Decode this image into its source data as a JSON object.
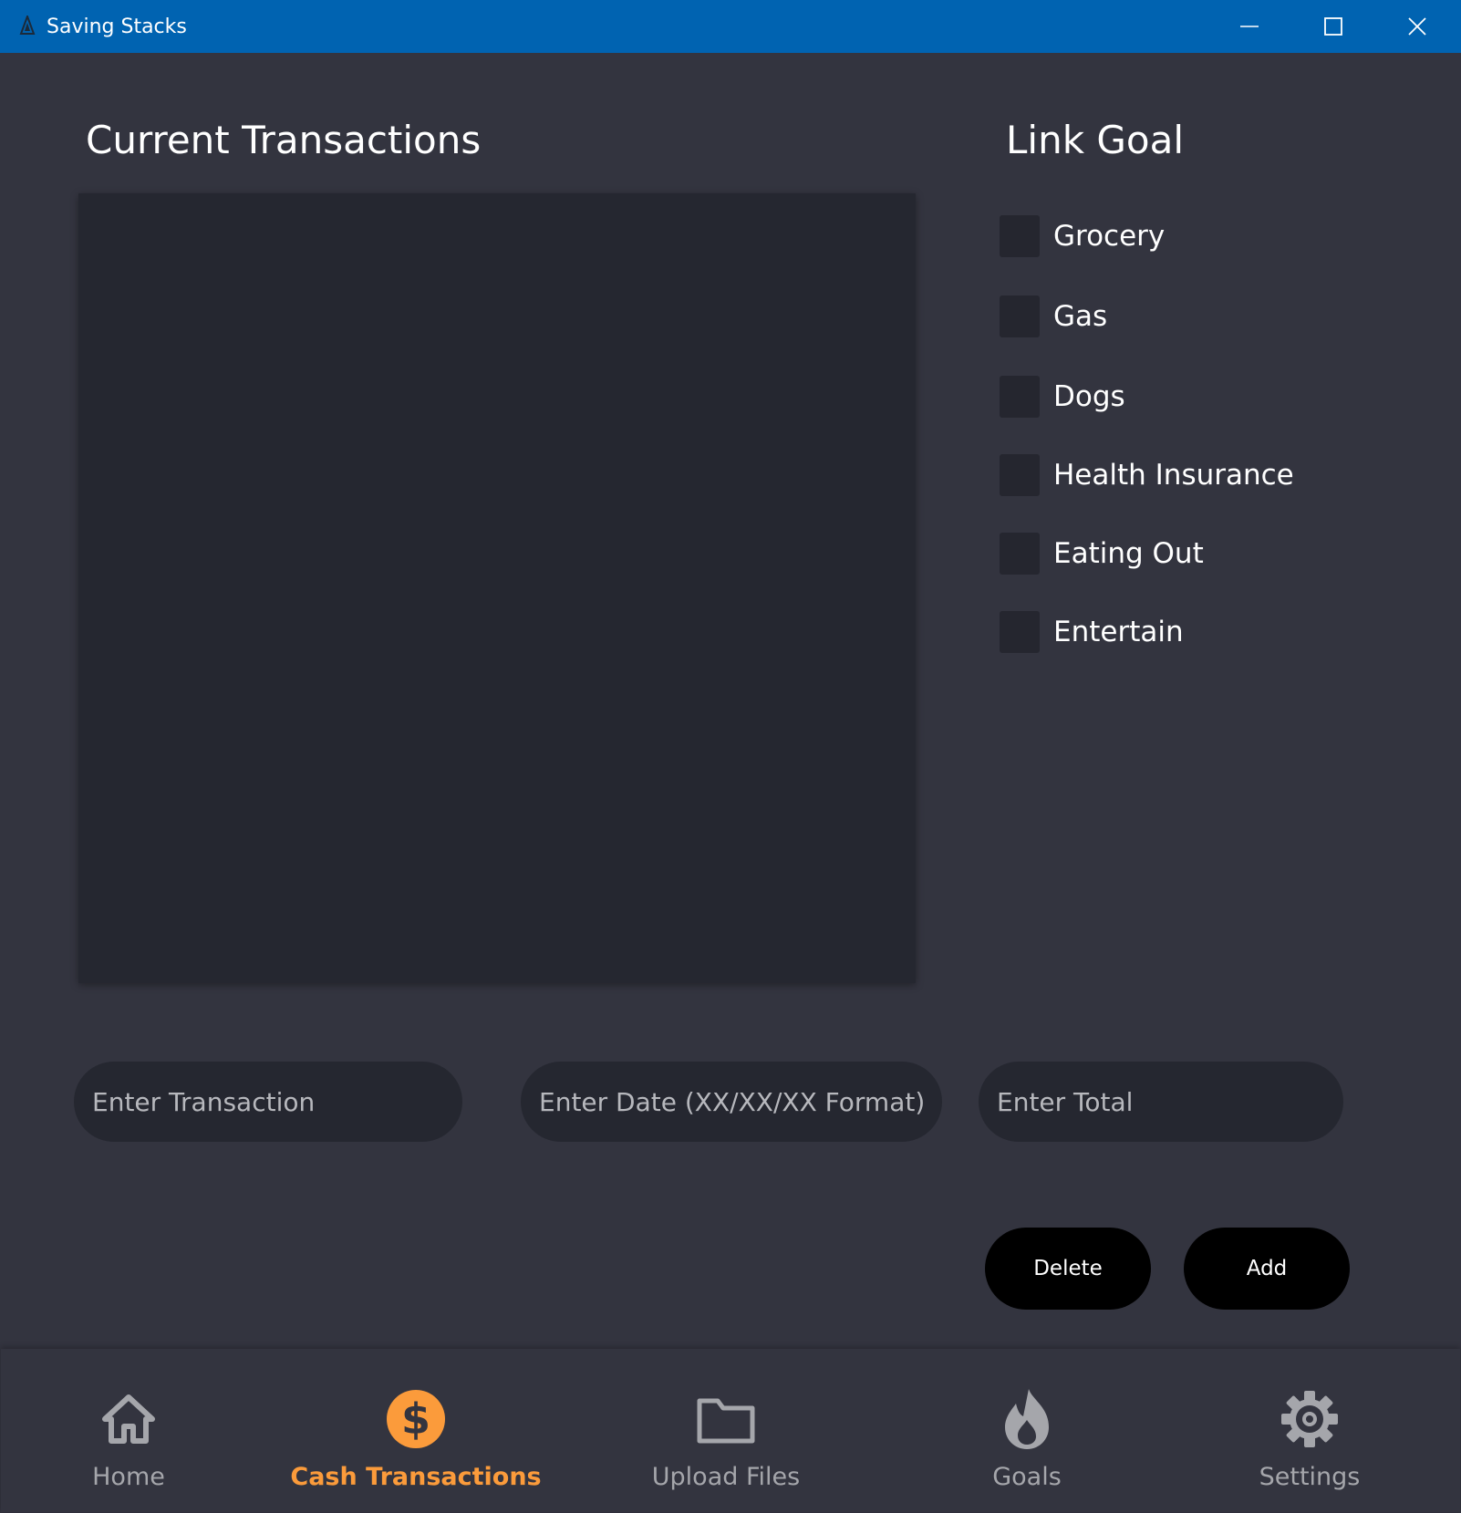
{
  "window": {
    "title": "Saving Stacks",
    "accent_color": "#0063b1",
    "background_color": "#33343f"
  },
  "transactions": {
    "heading": "Current Transactions",
    "items": []
  },
  "link_goal": {
    "heading": "Link Goal",
    "goals": [
      {
        "label": "Grocery",
        "checked": false
      },
      {
        "label": "Gas",
        "checked": false
      },
      {
        "label": "Dogs",
        "checked": false
      },
      {
        "label": "Health Insurance",
        "checked": false
      },
      {
        "label": "Eating Out",
        "checked": false
      },
      {
        "label": "Entertain",
        "checked": false
      }
    ]
  },
  "form": {
    "transaction_placeholder": "Enter Transaction",
    "transaction_value": "",
    "date_placeholder": "Enter Date (XX/XX/XX Format)",
    "date_value": "",
    "total_placeholder": "Enter Total",
    "total_value": "",
    "delete_label": "Delete",
    "add_label": "Add"
  },
  "nav": {
    "active_color": "#fb9b3b",
    "items": [
      {
        "label": "Home",
        "icon": "home-icon",
        "active": false
      },
      {
        "label": "Cash Transactions",
        "icon": "dollar-icon",
        "active": true
      },
      {
        "label": "Upload Files",
        "icon": "folder-icon",
        "active": false
      },
      {
        "label": "Goals",
        "icon": "flame-icon",
        "active": false
      },
      {
        "label": "Settings",
        "icon": "gear-icon",
        "active": false
      }
    ]
  }
}
